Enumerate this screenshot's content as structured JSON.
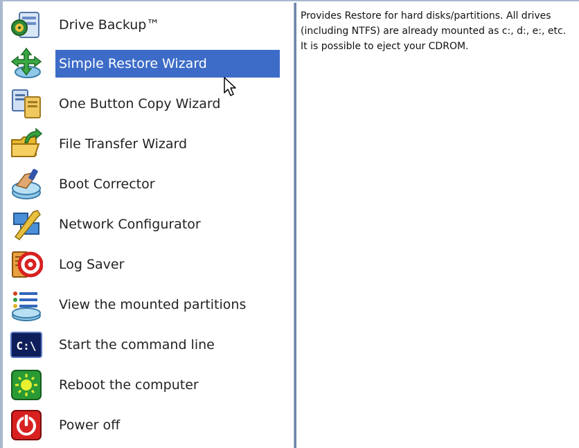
{
  "menu": {
    "items": [
      {
        "label": "Drive Backup™",
        "icon": "drive-backup-icon",
        "selected": false
      },
      {
        "label": "Simple Restore Wizard",
        "icon": "restore-wizard-icon",
        "selected": true
      },
      {
        "label": "One Button Copy Wizard",
        "icon": "copy-wizard-icon",
        "selected": false
      },
      {
        "label": "File Transfer Wizard",
        "icon": "file-transfer-icon",
        "selected": false
      },
      {
        "label": "Boot Corrector",
        "icon": "boot-corrector-icon",
        "selected": false
      },
      {
        "label": "Network Configurator",
        "icon": "network-config-icon",
        "selected": false
      },
      {
        "label": "Log Saver",
        "icon": "log-saver-icon",
        "selected": false
      },
      {
        "label": "View the mounted partitions",
        "icon": "mounted-partitions-icon",
        "selected": false
      },
      {
        "label": "Start the command line",
        "icon": "command-line-icon",
        "selected": false
      },
      {
        "label": "Reboot the computer",
        "icon": "reboot-icon",
        "selected": false
      },
      {
        "label": "Power off",
        "icon": "power-off-icon",
        "selected": false
      }
    ]
  },
  "description": {
    "text": "Provides Restore for hard disks/partitions. All drives (including NTFS) are already mounted as c:, d:, e:, etc. It is possible to eject your CDROM."
  },
  "colors": {
    "selection": "#3d6cc8",
    "divider": "#6f86a8",
    "frame": "#a9b8cf"
  }
}
